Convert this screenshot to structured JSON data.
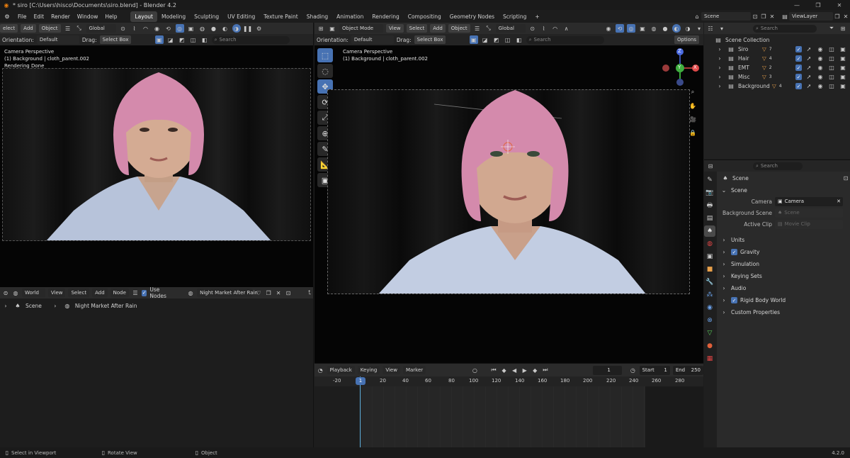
{
  "titlebar": {
    "title": "* siro [C:\\Users\\hisco\\Documents\\siro.blend] - Blender 4.2",
    "minimize": "—",
    "maximize": "❐",
    "close": "✕"
  },
  "menu": [
    "File",
    "Edit",
    "Render",
    "Window",
    "Help"
  ],
  "workspaces": [
    "Layout",
    "Modeling",
    "Sculpting",
    "UV Editing",
    "Texture Paint",
    "Shading",
    "Animation",
    "Rendering",
    "Compositing",
    "Geometry Nodes",
    "Scripting"
  ],
  "workspace_add": "+",
  "scene_selector": "Scene",
  "viewlayer_selector": "ViewLayer",
  "left_viewport": {
    "header": {
      "select": "elect",
      "add": "Add",
      "object": "Object",
      "transform": "Global",
      "search_placeholder": "Search"
    },
    "toolsettings": {
      "orientation_label": "Orientation:",
      "orientation_value": "Default",
      "drag_label": "Drag:",
      "drag_value": "Select Box"
    },
    "overlay": {
      "line1": "Camera Perspective",
      "line2": "(1) Background | cloth_parent.002",
      "line3": "Rendering Done"
    }
  },
  "main_viewport": {
    "header": {
      "mode": "Object Mode",
      "view": "View",
      "select": "Select",
      "add": "Add",
      "object": "Object",
      "transform": "Global"
    },
    "toolsettings": {
      "orientation_label": "Orientation:",
      "orientation_value": "Default",
      "drag_label": "Drag:",
      "drag_value": "Select Box",
      "search_placeholder": "Search",
      "options": "Options"
    },
    "overlay": {
      "line1": "Camera Perspective",
      "line2": "(1) Background | cloth_parent.002"
    },
    "gizmo": {
      "z": "Z",
      "y": "Y",
      "x": "X"
    }
  },
  "node_editor": {
    "header": {
      "type": "World",
      "view": "View",
      "select": "Select",
      "add": "Add",
      "node": "Node",
      "use_nodes": "Use Nodes",
      "world_name": "Night Market After Rain"
    },
    "breadcrumb": {
      "scene": "Scene",
      "world": "Night Market After Rain"
    }
  },
  "outliner": {
    "search_placeholder": "Search",
    "root": "Scene Collection",
    "items": [
      {
        "name": "Siro",
        "badge": "7"
      },
      {
        "name": "Hair",
        "badge": "4"
      },
      {
        "name": "EMT",
        "badge": "2"
      },
      {
        "name": "Misc",
        "badge": "3"
      },
      {
        "name": "Background",
        "badge": "4"
      }
    ]
  },
  "properties": {
    "search_placeholder": "Search",
    "context": "Scene",
    "panel_title": "Scene",
    "camera_label": "Camera",
    "camera_value": "Camera",
    "bg_scene_label": "Background Scene",
    "bg_scene_placeholder": "Scene",
    "active_clip_label": "Active Clip",
    "active_clip_placeholder": "Movie Clip",
    "panels": [
      {
        "label": "Units",
        "checkbox": false
      },
      {
        "label": "Gravity",
        "checkbox": true
      },
      {
        "label": "Simulation",
        "checkbox": false
      },
      {
        "label": "Keying Sets",
        "checkbox": false
      },
      {
        "label": "Audio",
        "checkbox": false
      },
      {
        "label": "Rigid Body World",
        "checkbox": true
      },
      {
        "label": "Custom Properties",
        "checkbox": false
      }
    ]
  },
  "timeline": {
    "playback": "Playback",
    "keying": "Keying",
    "view": "View",
    "marker": "Marker",
    "current_frame": "1",
    "start_label": "Start",
    "start": "1",
    "end_label": "End",
    "end": "250",
    "ruler": [
      "-20",
      "20",
      "40",
      "60",
      "80",
      "100",
      "120",
      "140",
      "160",
      "180",
      "200",
      "220",
      "240",
      "260",
      "280"
    ],
    "playhead": "1"
  },
  "statusbar": {
    "left": "Select in Viewport",
    "middle": "Rotate View",
    "right": "Object",
    "version": "4.2.0"
  },
  "colors": {
    "accent": "#4772b3",
    "background": "#1d1d1d",
    "header": "#2b2b2b",
    "playhead": "#5baddb",
    "hair": "#d48aac"
  }
}
